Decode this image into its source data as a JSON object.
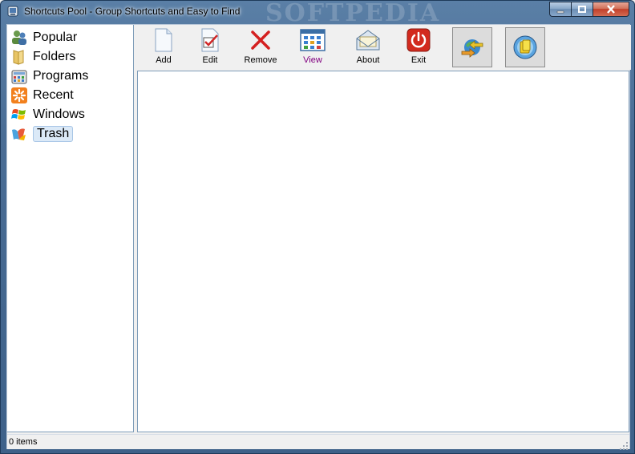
{
  "window": {
    "title": "Shortcuts Pool - Group Shortcuts and Easy to Find",
    "watermark": "SOFTPEDIA"
  },
  "sidebar": {
    "items": [
      {
        "label": "Popular",
        "icon": "users-icon"
      },
      {
        "label": "Folders",
        "icon": "folder-icon"
      },
      {
        "label": "Programs",
        "icon": "calculator-icon"
      },
      {
        "label": "Recent",
        "icon": "recent-icon"
      },
      {
        "label": "Windows",
        "icon": "windows-logo-icon"
      },
      {
        "label": "Trash",
        "icon": "trash-icon"
      }
    ],
    "selected": "Trash"
  },
  "toolbar": {
    "add": "Add",
    "edit": "Edit",
    "remove": "Remove",
    "view": "View",
    "about": "About",
    "exit": "Exit"
  },
  "status": {
    "text": "0 items"
  },
  "colors": {
    "titlebar": "#4a6d95",
    "view_label": "#800080",
    "remove_icon": "#d42020",
    "exit_icon": "#d22a1e",
    "selection": "#dbe9f7"
  }
}
